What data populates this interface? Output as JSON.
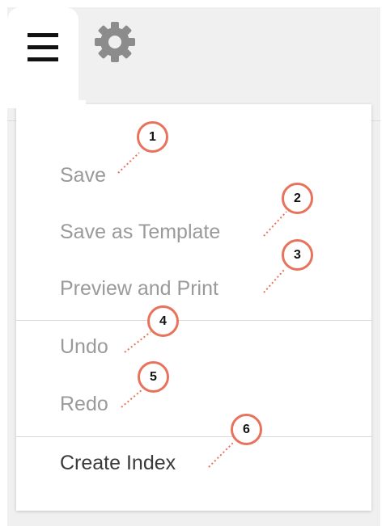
{
  "toolbar": {
    "menu_icon": "hamburger-icon",
    "settings_icon": "gear-icon"
  },
  "menu": {
    "items": [
      {
        "label": "Save",
        "enabled": false
      },
      {
        "label": "Save as Template",
        "enabled": false
      },
      {
        "label": "Preview and Print",
        "enabled": false
      },
      {
        "label": "Undo",
        "enabled": false
      },
      {
        "label": "Redo",
        "enabled": false
      },
      {
        "label": "Create Index",
        "enabled": true
      }
    ]
  },
  "callouts": [
    "1",
    "2",
    "3",
    "4",
    "5",
    "6"
  ],
  "colors": {
    "callout": "#e8725b",
    "disabled_text": "#9a9a9a",
    "enabled_text": "#3a3a3a"
  }
}
